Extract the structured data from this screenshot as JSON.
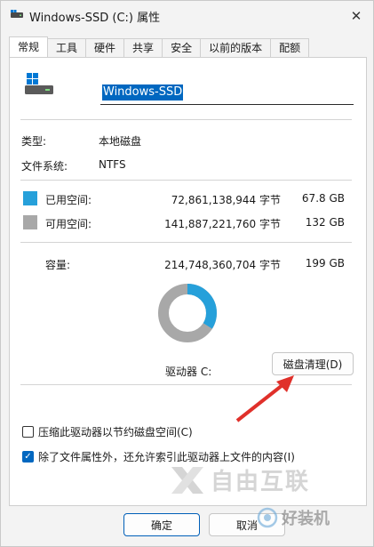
{
  "window": {
    "title": "Windows-SSD (C:) 属性",
    "close_label": "✕"
  },
  "tabs": [
    {
      "label": "常规",
      "active": true
    },
    {
      "label": "工具",
      "active": false
    },
    {
      "label": "硬件",
      "active": false
    },
    {
      "label": "共享",
      "active": false
    },
    {
      "label": "安全",
      "active": false
    },
    {
      "label": "以前的版本",
      "active": false
    },
    {
      "label": "配额",
      "active": false
    }
  ],
  "general": {
    "name_value": "Windows-SSD",
    "type_label": "类型:",
    "type_value": "本地磁盘",
    "fs_label": "文件系统:",
    "fs_value": "NTFS",
    "used_label": "已用空间:",
    "used_bytes": "72,861,138,944 字节",
    "used_size": "67.8 GB",
    "free_label": "可用空间:",
    "free_bytes": "141,887,221,760 字节",
    "free_size": "132 GB",
    "capacity_label": "容量:",
    "capacity_bytes": "214,748,360,704 字节",
    "capacity_size": "199 GB",
    "drive_label": "驱动器 C:",
    "cleanup_button": "磁盘清理(D)",
    "compress_label": "压缩此驱动器以节约磁盘空间(C)",
    "compress_checked": false,
    "index_label": "除了文件属性外，还允许索引此驱动器上文件的内容(I)",
    "index_checked": true,
    "usage_fraction_used": 0.3393
  },
  "colors": {
    "used": "#26a0da",
    "free": "#a8a8a8",
    "accent": "#0067c0",
    "arrow": "#e0302a"
  },
  "footer": {
    "ok_button": "确定",
    "cancel_button": "取消"
  },
  "watermark": {
    "brand": "自由互联",
    "site": "好装机"
  }
}
